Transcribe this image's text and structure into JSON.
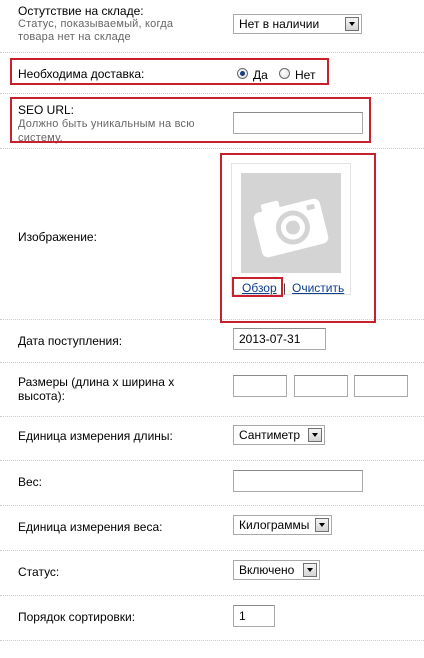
{
  "out_of_stock": {
    "label": "Остутствие на складе:",
    "help_line1": "Статус, показываемый, когда",
    "help_line2": "товара нет на складе",
    "value": "Нет в наличии"
  },
  "shipping": {
    "label": "Необходима доставка:",
    "yes_label": "Да",
    "no_label": "Нет",
    "selected": "yes"
  },
  "seo_url": {
    "label": "SEO URL:",
    "help_line1": "Должно быть уникальным на всю",
    "help_line2": "систему.",
    "value": ""
  },
  "image": {
    "label": "Изображение:",
    "browse_label": "Обзор",
    "separator": "|",
    "clear_label": "Очистить",
    "placeholder_icon": "camera-icon"
  },
  "date_available": {
    "label": "Дата поступления:",
    "value": "2013-07-31"
  },
  "dimensions": {
    "label_line1": "Размеры (длина х ширина х",
    "label_line2": "высота):",
    "length": "",
    "width": "",
    "height": ""
  },
  "length_class": {
    "label": "Единица измерения длины:",
    "value": "Сантиметр"
  },
  "weight": {
    "label": "Вес:",
    "value": ""
  },
  "weight_class": {
    "label": "Единица измерения веса:",
    "value": "Килограммы"
  },
  "status": {
    "label": "Статус:",
    "value": "Включено"
  },
  "sort_order": {
    "label": "Порядок сортировки:",
    "value": "1"
  },
  "colors": {
    "highlight": "#c8202c",
    "link": "#0c3f8c",
    "help_text": "#666666"
  }
}
